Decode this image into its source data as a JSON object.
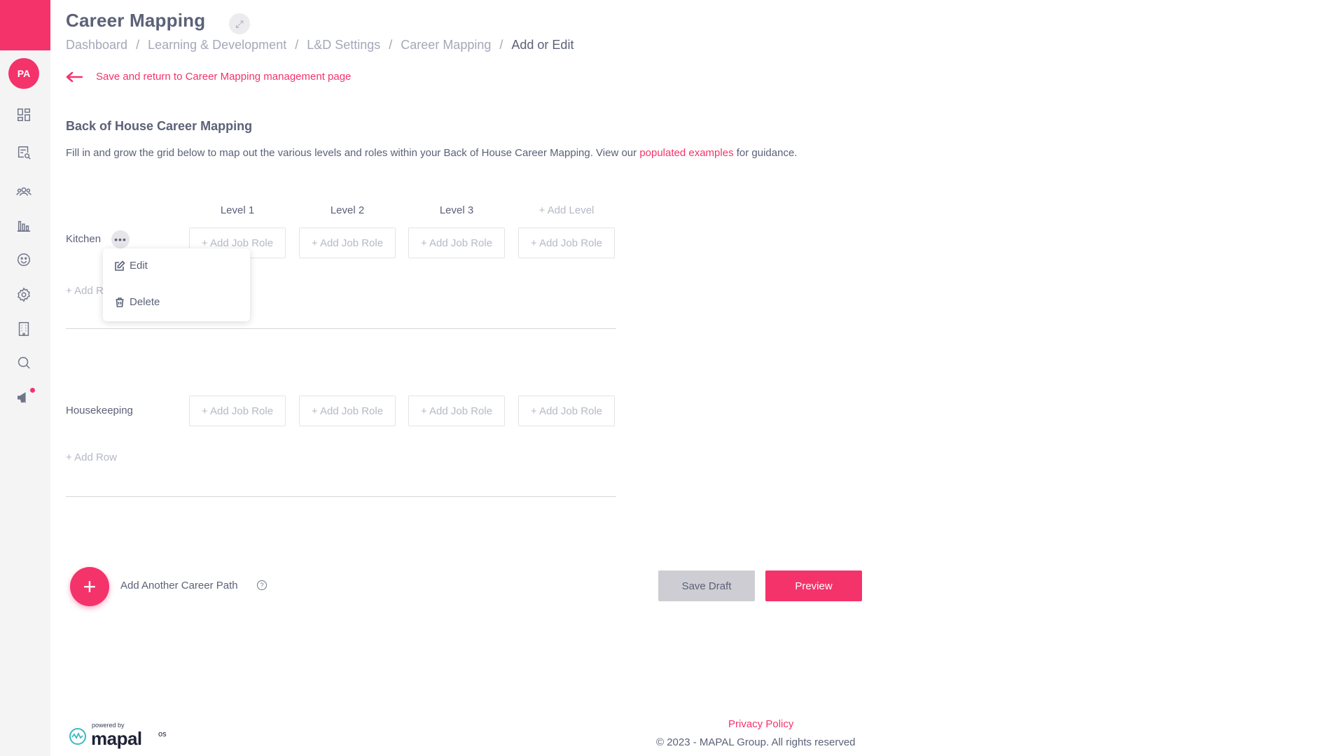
{
  "sidebar": {
    "avatar_initials": "PA",
    "items": [
      {
        "icon": "dashboard-icon"
      },
      {
        "icon": "search-document-icon"
      },
      {
        "icon": "people-icon"
      },
      {
        "icon": "bar-chart-icon"
      },
      {
        "icon": "smiley-icon"
      },
      {
        "icon": "gear-icon"
      },
      {
        "icon": "building-icon"
      },
      {
        "icon": "search-icon"
      },
      {
        "icon": "megaphone-icon"
      }
    ]
  },
  "header": {
    "title": "Career Mapping",
    "breadcrumb": [
      "Dashboard",
      "Learning & Development",
      "L&D Settings",
      "Career Mapping",
      "Add or Edit"
    ]
  },
  "back_link": "Save and return to Career Mapping management page",
  "section": {
    "title": "Back of House Career Mapping",
    "desc_before": "Fill in and grow the grid below to map out the various levels and roles within your Back of House Career Mapping. View our ",
    "desc_link": "populated examples",
    "desc_after": " for guidance."
  },
  "grid": {
    "levels": [
      "Level 1",
      "Level 2",
      "Level 3"
    ],
    "add_level": "+ Add Level",
    "add_job_role": "+ Add Job Role",
    "rows": [
      {
        "label": "Kitchen",
        "more": "•••",
        "add_row": "+ Add Row"
      },
      {
        "label": "Housekeeping",
        "add_row": "+ Add Row"
      }
    ]
  },
  "context_menu": {
    "edit": "Edit",
    "delete": "Delete"
  },
  "actions": {
    "add_path_symbol": "+",
    "add_path_label": "Add Another Career Path",
    "help_symbol": "?",
    "save_draft": "Save Draft",
    "preview": "Preview"
  },
  "footer": {
    "powered_by": "powered by",
    "brand": "mapal",
    "brand_suffix": "os",
    "privacy": "Privacy Policy",
    "copyright": "© 2023 - MAPAL Group. All rights reserved"
  },
  "colors": {
    "accent": "#f4336b",
    "text": "#5b6178",
    "muted": "#b5b9c6",
    "sidebar_bg": "#f4f4f5"
  }
}
